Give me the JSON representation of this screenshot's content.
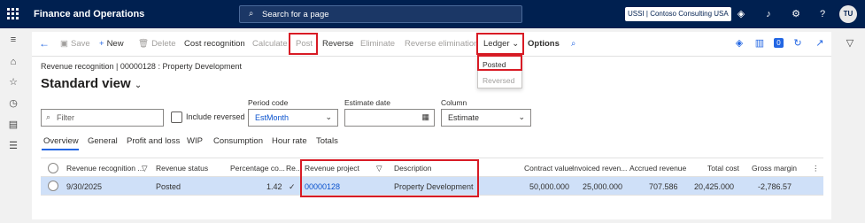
{
  "app": {
    "title": "Finance and Operations",
    "search_placeholder": "Search for a page",
    "company": "USSI | Contoso Consulting USA",
    "user_initials": "TU"
  },
  "toolbar": {
    "save": "Save",
    "new": "New",
    "delete": "Delete",
    "cost_recognition": "Cost recognition",
    "calculate": "Calculate",
    "post": "Post",
    "reverse": "Reverse",
    "eliminate": "Eliminate",
    "reverse_elimination": "Reverse elimination",
    "ledger": "Ledger",
    "options": "Options",
    "notification_count": "0"
  },
  "ledger_menu": {
    "items": [
      "Posted",
      "Reversed"
    ]
  },
  "page": {
    "breadcrumb": "Revenue recognition  |  00000128 : Property Development",
    "view_title": "Standard view"
  },
  "filters": {
    "filter_placeholder": "Filter",
    "include_reversed": "Include reversed",
    "period_code_label": "Period code",
    "period_code_value": "EstMonth",
    "estimate_date_label": "Estimate date",
    "estimate_date_value": "",
    "column_label": "Column",
    "column_value": "Estimate"
  },
  "tabs": [
    "Overview",
    "General",
    "Profit and loss",
    "WIP",
    "Consumption",
    "Hour rate",
    "Totals"
  ],
  "grid": {
    "columns": [
      "Revenue recognition ...",
      "Revenue status",
      "Percentage co...",
      "Re...",
      "Revenue project",
      "Description",
      "Contract value",
      "Invoiced reven...",
      "Accrued revenue",
      "Total cost",
      "Gross margin"
    ],
    "rows": [
      {
        "date": "9/30/2025",
        "status": "Posted",
        "percentage": "1.42",
        "re": "✓",
        "project": "00000128",
        "description": "Property Development",
        "contract_value": "50,000.000",
        "invoiced": "25,000.000",
        "accrued": "707.586",
        "total_cost": "20,425.000",
        "gross_margin": "-2,786.57"
      }
    ]
  }
}
